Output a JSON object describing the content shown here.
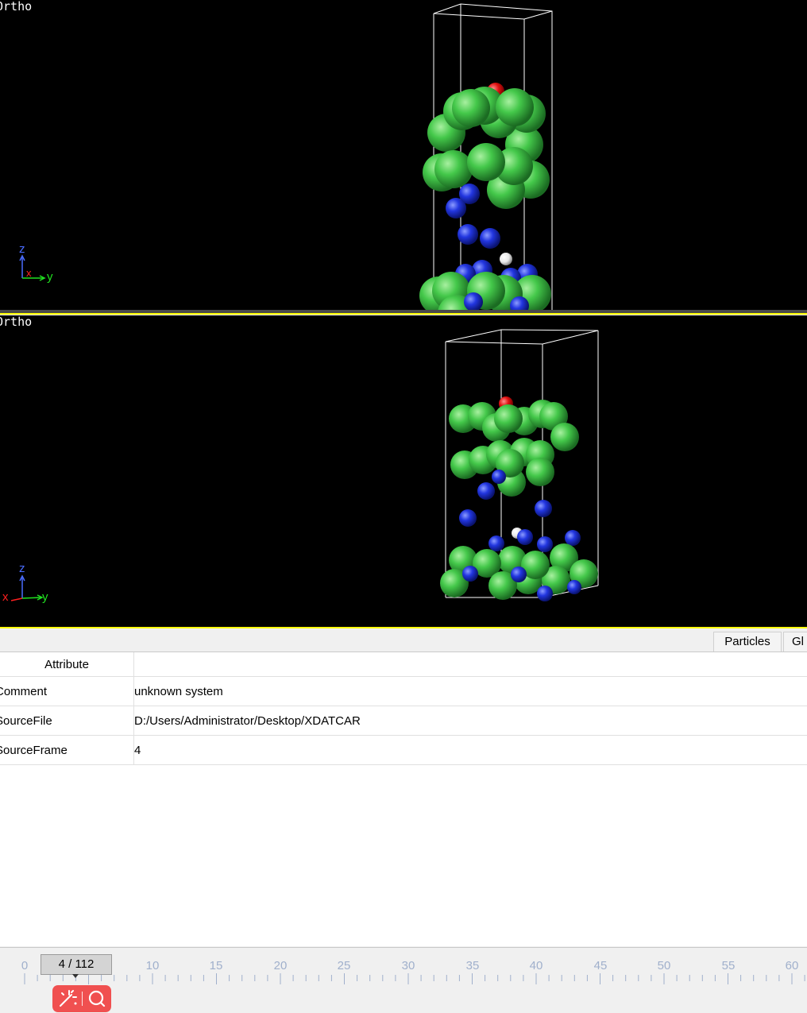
{
  "viewports": [
    {
      "label": "Ortho",
      "axes": {
        "z": "z",
        "x": "x",
        "y": "y"
      }
    },
    {
      "label": "Ortho",
      "axes": {
        "z": "z",
        "x": "x",
        "y": "y"
      }
    }
  ],
  "colors": {
    "nitrogen_blue": "#2236e0",
    "chlorine_green": "#3cc84a",
    "oxygen_red": "#e01010",
    "hydrogen_white": "#f2f2f2",
    "active_border": "#ffff00",
    "axis_x": "#ff2020",
    "axis_y": "#20e020",
    "axis_z": "#4a6cff"
  },
  "tabs": [
    {
      "label": "Particles"
    },
    {
      "label": "Gl"
    }
  ],
  "attributes_table": {
    "header": "Attribute",
    "rows": [
      {
        "attribute": "Comment",
        "value": "unknown system"
      },
      {
        "attribute": "SourceFile",
        "value": "D:/Users/Administrator/Desktop/XDATCAR"
      },
      {
        "attribute": "SourceFrame",
        "value": "4"
      }
    ]
  },
  "timeline": {
    "current_frame": "4 / 112",
    "tick_labels": [
      "0",
      "10",
      "15",
      "20",
      "25",
      "30",
      "35",
      "40",
      "45",
      "50",
      "55",
      "60"
    ]
  },
  "toolbar_icons": [
    "magic-wand-icon",
    "search-icon"
  ]
}
